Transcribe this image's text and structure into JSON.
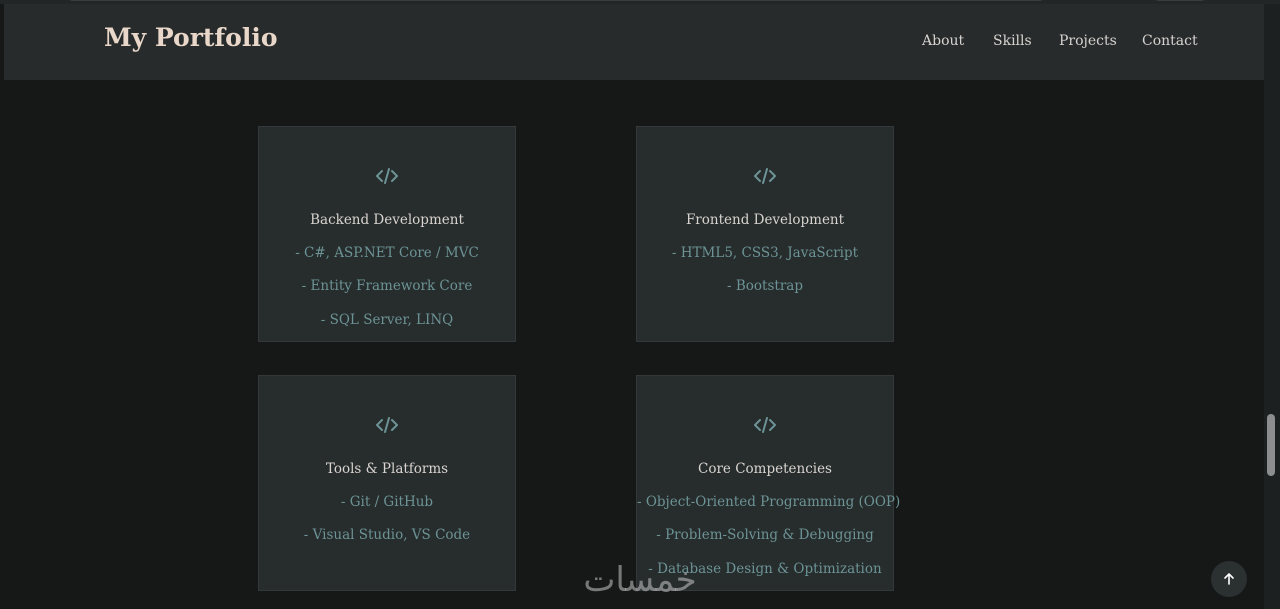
{
  "navbar": {
    "brand": "My Portfolio",
    "links": [
      "About",
      "Skills",
      "Projects",
      "Contact"
    ]
  },
  "cards": [
    {
      "icon": "code-icon",
      "title": "Backend Development",
      "items": [
        "- C#, ASP.NET Core / MVC",
        "- Entity Framework Core",
        "- SQL Server, LINQ"
      ]
    },
    {
      "icon": "code-icon",
      "title": "Frontend Development",
      "items": [
        "- HTML5, CSS3, JavaScript",
        "- Bootstrap"
      ]
    },
    {
      "icon": "code-icon",
      "title": "Tools & Platforms",
      "items": [
        "- Git / GitHub",
        "- Visual Studio, VS Code"
      ]
    },
    {
      "icon": "code-icon",
      "title": "Core Competencies",
      "items": [
        "- Object-Oriented Programming (OOP)",
        "- Problem-Solving & Debugging",
        "- Database Design & Optimization"
      ]
    }
  ],
  "watermark": "خمسات",
  "scroll_top_icon": "arrow-up-icon",
  "colors": {
    "background": "#151817",
    "navbar": "#272b2c",
    "card": "#272c2d",
    "accent": "#6c9395",
    "brand": "#e9d8c9"
  }
}
